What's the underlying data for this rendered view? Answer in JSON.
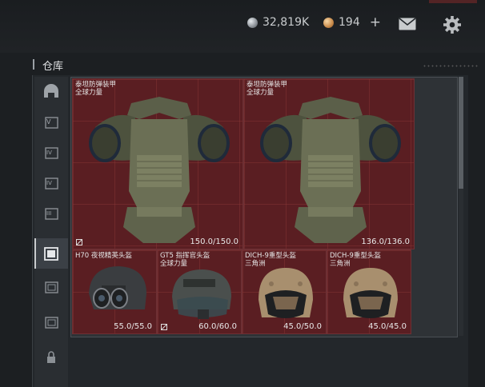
{
  "header": {
    "silver_amount": "32,819K",
    "gold_amount": "194",
    "silver_icon": "silver-coin-icon",
    "gold_icon": "gold-coin-icon",
    "mail_icon": "mail-icon",
    "settings_icon": "gear-icon"
  },
  "section": {
    "title": "仓库"
  },
  "sidebar": {
    "items": [
      {
        "icon": "helmet-category-icon",
        "active": false
      },
      {
        "icon": "armor-v-icon",
        "active": false
      },
      {
        "icon": "armor-iv-icon",
        "active": false
      },
      {
        "icon": "armor-iv-alt-icon",
        "active": false
      },
      {
        "icon": "armor-iii-icon",
        "active": false
      },
      {
        "icon": "armor-selected-icon",
        "active": true
      },
      {
        "icon": "armor-ii-icon",
        "active": false
      },
      {
        "icon": "armor-i-icon",
        "active": false
      },
      {
        "icon": "lock-icon",
        "active": false
      }
    ]
  },
  "colors": {
    "cell_bg": "#5a1e22",
    "background": "#1c1f22",
    "accent": "#c9ccce"
  },
  "inventory": {
    "items": [
      {
        "name_line1": "泰坦防弹装甲",
        "name_line2": "全球力量",
        "durability": "150.0/150.0",
        "icon": "body-armor-icon"
      },
      {
        "name_line1": "泰坦防弹装甲",
        "name_line2": "全球力量",
        "durability": "136.0/136.0",
        "icon": "body-armor-icon"
      },
      {
        "name_line1": "H70 夜视精英头盔",
        "name_line2": "",
        "durability": "55.0/55.0",
        "icon": "nightvision-helmet-icon"
      },
      {
        "name_line1": "GT5 指挥官头盔",
        "name_line2": "全球力量",
        "durability": "60.0/60.0",
        "icon": "tactical-helmet-icon"
      },
      {
        "name_line1": "DICH-9重型头盔",
        "name_line2": "三角洲",
        "durability": "45.0/50.0",
        "icon": "heavy-helmet-icon"
      },
      {
        "name_line1": "DICH-9重型头盔",
        "name_line2": "三角洲",
        "durability": "45.0/45.0",
        "icon": "heavy-helmet-icon"
      }
    ]
  }
}
